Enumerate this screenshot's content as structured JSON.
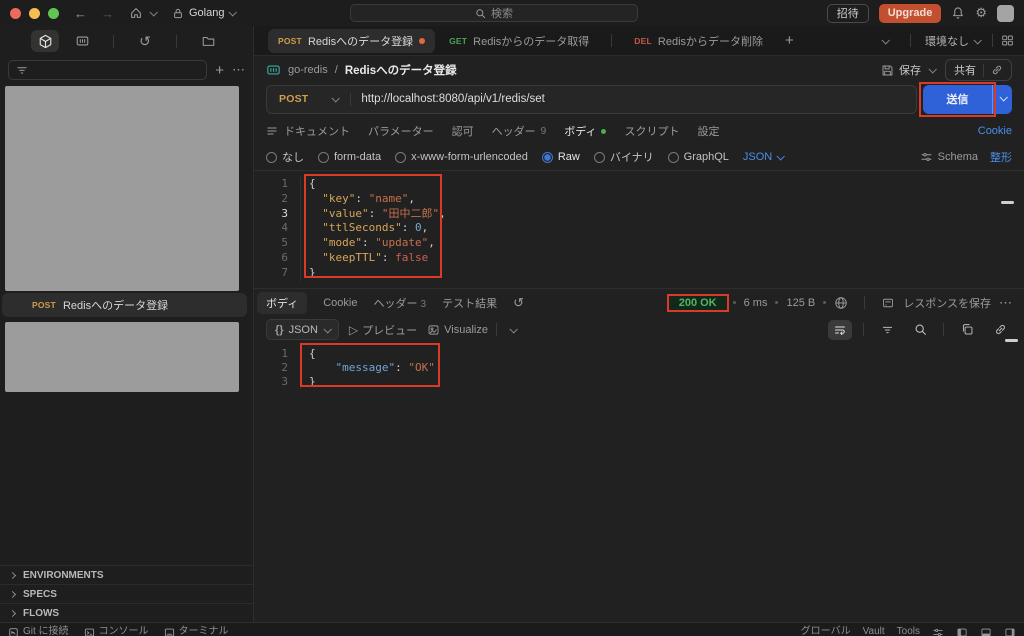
{
  "colors": {
    "annotation_red": "#da3b28",
    "send_blue": "#2f62d8",
    "status_green": "#51b563",
    "accent_blue": "#4b8ee8",
    "method_post": "#cf9d4e",
    "method_get": "#4ca258",
    "method_del": "#c05b49",
    "upgrade_orange": "#c25030",
    "redacted_gray": "#9c9c9c"
  },
  "icons": {
    "back": "←",
    "forward": "→",
    "history": "↺",
    "plus": "+",
    "more": "⋯",
    "gear": "⚙",
    "play": "▷",
    "braces": "{}"
  },
  "topbar": {
    "workspace": "Golang",
    "search_placeholder": "検索",
    "invite_label": "招待",
    "upgrade_label": "Upgrade"
  },
  "tabstrip": {
    "tabs": [
      {
        "method": "POST",
        "label": "Redisへのデータ登録",
        "active": true,
        "dirty": true
      },
      {
        "method": "GET",
        "label": "Redisからのデータ取得",
        "active": false
      },
      {
        "method": "DEL",
        "label": "Redisからデータ削除",
        "active": false
      }
    ],
    "env_selector": "環境なし"
  },
  "sidebar": {
    "item": {
      "method": "POST",
      "label": "Redisへのデータ登録"
    },
    "sections": [
      {
        "label": "ENVIRONMENTS"
      },
      {
        "label": "SPECS"
      },
      {
        "label": "FLOWS"
      }
    ]
  },
  "request": {
    "breadcrumb": {
      "collection": "go-redis",
      "separator": "/",
      "name": "Redisへのデータ登録"
    },
    "save_label": "保存",
    "share_label": "共有",
    "method": "POST",
    "url": "http://localhost:8080/api/v1/redis/set",
    "send_label": "送信",
    "tabs": {
      "documentation": "ドキュメント",
      "params": "パラメーター",
      "auth": "認可",
      "headers": "ヘッダー",
      "headers_count": "9",
      "body": "ボディ",
      "scripts": "スクリプト",
      "settings": "設定",
      "cookies": "Cookie"
    },
    "body_types": {
      "none": "なし",
      "formdata": "form-data",
      "urlencoded": "x-www-form-urlencoded",
      "raw": "Raw",
      "binary": "バイナリ",
      "graphql": "GraphQL",
      "raw_language": "JSON"
    },
    "schema_label": "Schema",
    "beautify_label": "整形",
    "body_lines": [
      {
        "n": "1",
        "segs": [
          {
            "t": "{",
            "c": "p"
          }
        ]
      },
      {
        "n": "2",
        "segs": [
          {
            "t": "  ",
            "c": "p"
          },
          {
            "t": "\"key\"",
            "c": "key"
          },
          {
            "t": ": ",
            "c": "p"
          },
          {
            "t": "\"name\"",
            "c": "str"
          },
          {
            "t": ",",
            "c": "p"
          }
        ]
      },
      {
        "n": "3",
        "hl": true,
        "segs": [
          {
            "t": "  ",
            "c": "p"
          },
          {
            "t": "\"value\"",
            "c": "key"
          },
          {
            "t": ": ",
            "c": "p"
          },
          {
            "t": "\"田中二郎\"",
            "c": "str"
          },
          {
            "t": ",",
            "c": "p"
          }
        ]
      },
      {
        "n": "4",
        "segs": [
          {
            "t": "  ",
            "c": "p"
          },
          {
            "t": "\"ttlSeconds\"",
            "c": "key"
          },
          {
            "t": ": ",
            "c": "p"
          },
          {
            "t": "0",
            "c": "num"
          },
          {
            "t": ",",
            "c": "p"
          }
        ]
      },
      {
        "n": "5",
        "segs": [
          {
            "t": "  ",
            "c": "p"
          },
          {
            "t": "\"mode\"",
            "c": "key"
          },
          {
            "t": ": ",
            "c": "p"
          },
          {
            "t": "\"update\"",
            "c": "str"
          },
          {
            "t": ",",
            "c": "p"
          }
        ]
      },
      {
        "n": "6",
        "segs": [
          {
            "t": "  ",
            "c": "p"
          },
          {
            "t": "\"keepTTL\"",
            "c": "key"
          },
          {
            "t": ": ",
            "c": "p"
          },
          {
            "t": "false",
            "c": "bool"
          }
        ]
      },
      {
        "n": "7",
        "segs": [
          {
            "t": "}",
            "c": "p"
          }
        ]
      }
    ]
  },
  "response": {
    "tabs": {
      "body": "ボディ",
      "cookies": "Cookie",
      "headers": "ヘッダー",
      "headers_count": "3",
      "tests": "テスト結果"
    },
    "status": "200 OK",
    "time": "6 ms",
    "size": "125 B",
    "save_label": "レスポンスを保存",
    "format": "JSON",
    "preview_label": "プレビュー",
    "visualize_label": "Visualize",
    "body_lines": [
      {
        "n": "1",
        "segs": [
          {
            "t": "{",
            "c": "p"
          }
        ]
      },
      {
        "n": "2",
        "segs": [
          {
            "t": "    ",
            "c": "p"
          },
          {
            "t": "\"message\"",
            "c": "rkey"
          },
          {
            "t": ": ",
            "c": "p"
          },
          {
            "t": "\"OK\"",
            "c": "str"
          }
        ]
      },
      {
        "n": "3",
        "segs": [
          {
            "t": "}",
            "c": "p"
          }
        ]
      }
    ]
  },
  "statusbar": {
    "git": "Git に接続",
    "console": "コンソール",
    "terminal": "ターミナル",
    "global": "グローバル",
    "vault": "Vault",
    "tools": "Tools"
  }
}
